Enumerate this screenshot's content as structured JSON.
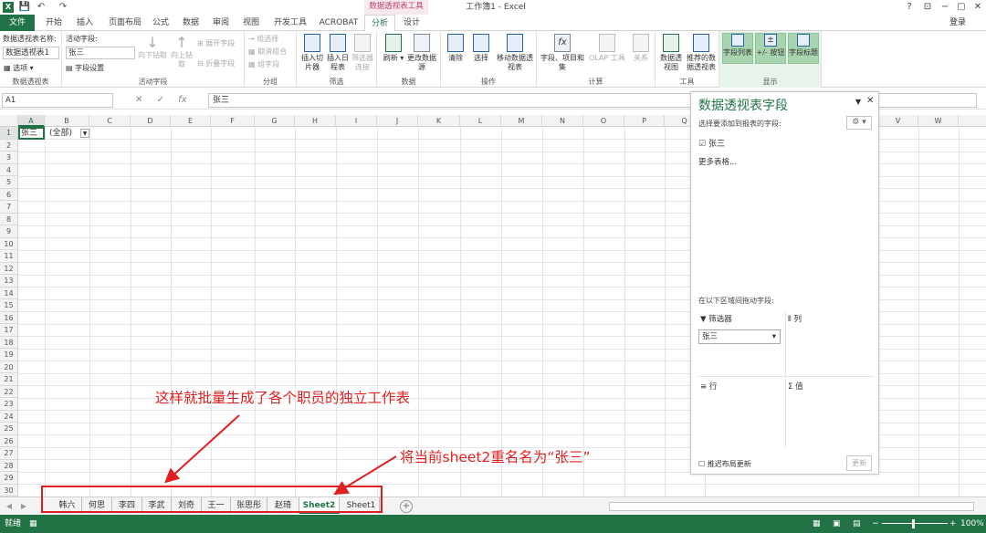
{
  "window": {
    "title": "工作簿1 - Excel",
    "context_tab": "数据透视表工具",
    "help": "?",
    "restore": "⊡",
    "minimize": "−",
    "maximize": "▢",
    "close": "✕",
    "login": "登录"
  },
  "quick_access": {
    "save": "💾",
    "undo": "↶",
    "redo": "↷"
  },
  "tabs": [
    "文件",
    "开始",
    "插入",
    "页面布局",
    "公式",
    "数据",
    "审阅",
    "视图",
    "开发工具",
    "ACROBAT",
    "分析",
    "设计"
  ],
  "active_tab": "分析",
  "ribbon": {
    "pivot": {
      "name_label": "数据透视表名称:",
      "name_value": "数据透视表1",
      "options": "选项",
      "group": "数据透视表"
    },
    "active_field": {
      "label": "活动字段:",
      "value": "张三",
      "field_settings": "字段设置",
      "drill_down": "向下钻取",
      "drill_up": "向上钻取",
      "expand": "展开字段",
      "collapse": "折叠字段",
      "group": "活动字段"
    },
    "grouping": {
      "selection": "组选择",
      "ungroup": "取消组合",
      "field": "组字段",
      "group": "分组"
    },
    "filter": {
      "slicer": "插入切片器",
      "timeline": "插入日程表",
      "connections": "筛选器连接",
      "group": "筛选"
    },
    "data": {
      "refresh": "刷新",
      "change_source": "更改数据源",
      "group": "数据"
    },
    "actions": {
      "clear": "清除",
      "select": "选择",
      "move": "移动数据透视表",
      "group": "操作"
    },
    "calc": {
      "fields": "字段、项目和集",
      "olap": "OLAP 工具",
      "relations": "关系",
      "group": "计算"
    },
    "tools": {
      "chart": "数据透视图",
      "recommended": "推荐的数据透视表",
      "group": "工具"
    },
    "show": {
      "field_list": "字段列表",
      "buttons": "+/- 按钮",
      "headers": "字段标题",
      "group": "显示"
    }
  },
  "formula_bar": {
    "name_box": "A1",
    "value": "张三",
    "fx": "fx"
  },
  "grid": {
    "columns": [
      "A",
      "B",
      "C",
      "D",
      "E",
      "F",
      "G",
      "H",
      "I",
      "J",
      "K",
      "L",
      "M",
      "N",
      "O",
      "P",
      "Q",
      "V",
      "W"
    ],
    "rows": 30,
    "cell_a1": "张三",
    "cell_b1": "(全部)"
  },
  "sheets": [
    "韩六",
    "何思",
    "李四",
    "李武",
    "刘奇",
    "王一",
    "张思彤",
    "赵琦",
    "Sheet2",
    "Sheet1"
  ],
  "active_sheet": "Sheet2",
  "status": {
    "ready": "就绪",
    "zoom": "100%"
  },
  "pivot_pane": {
    "title": "数据透视表字段",
    "subtitle": "选择要添加到报表的字段:",
    "field": "张三",
    "more_tables": "更多表格...",
    "drag_hint": "在以下区域间拖动字段:",
    "areas": {
      "filters": "筛选器",
      "columns": "列",
      "rows": "行",
      "values": "值"
    },
    "filter_value": "张三",
    "defer": "推迟布局更新",
    "update": "更新"
  },
  "annotations": {
    "main": "这样就批量生成了各个职员的独立工作表",
    "rename": "将当前sheet2重名名为“张三”"
  },
  "colors": {
    "excel_green": "#217346",
    "annotation_red": "#e02020"
  }
}
